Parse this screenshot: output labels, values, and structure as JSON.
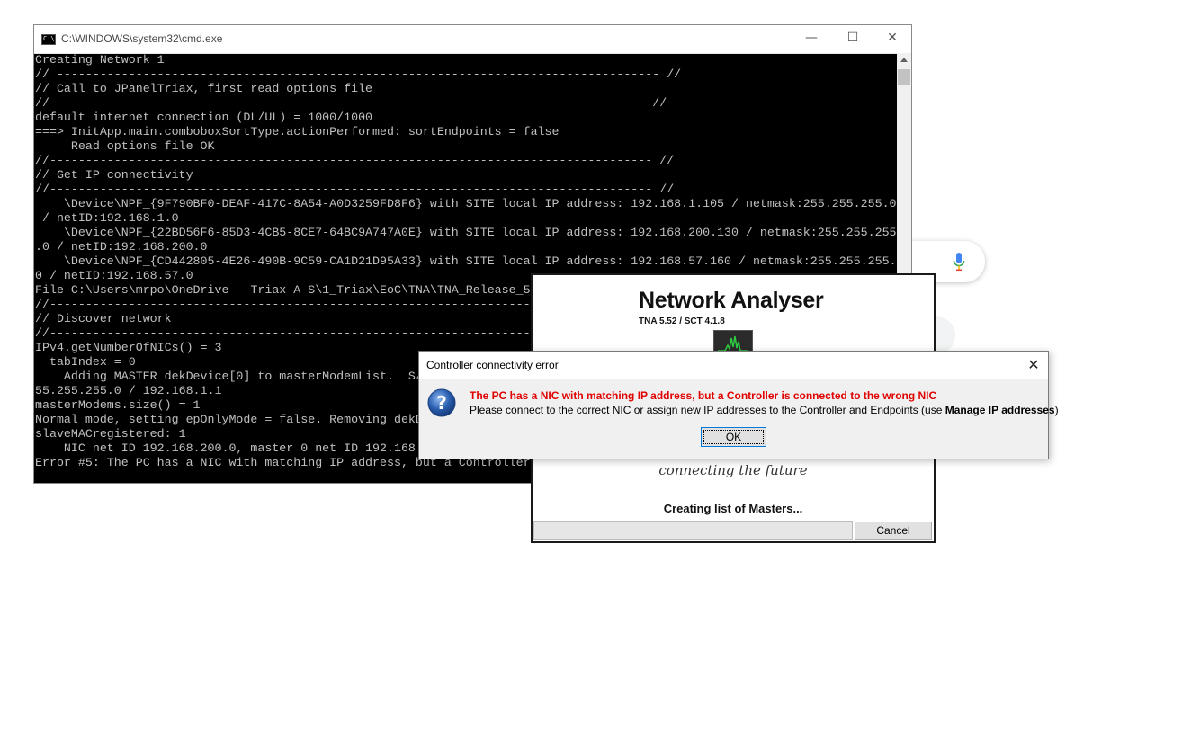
{
  "cmd": {
    "title": "C:\\WINDOWS\\system32\\cmd.exe",
    "icon_label": "C:\\",
    "lines": [
      "Creating Network 1",
      "// ------------------------------------------------------------------------------------ //",
      "// Call to JPanelTriax, first read options file",
      "// -----------------------------------------------------------------------------------//",
      "default internet connection (DL/UL) = 1000/1000",
      "===> InitApp.main.comboboxSortType.actionPerformed: sortEndpoints = false",
      "     Read options file OK",
      "//------------------------------------------------------------------------------------ //",
      "// Get IP connectivity",
      "//------------------------------------------------------------------------------------ //",
      "    \\Device\\NPF_{9F790BF0-DEAF-417C-8A54-A0D3259FD8F6} with SITE local IP address: 192.168.1.105 / netmask:255.255.255.0",
      " / netID:192.168.1.0",
      "    \\Device\\NPF_{22BD56F6-85D3-4CB5-8CE7-64BC9A747A0E} with SITE local IP address: 192.168.200.130 / netmask:255.255.255",
      ".0 / netID:192.168.200.0",
      "    \\Device\\NPF_{CD442805-4E26-490B-9C59-CA1D21D95A33} with SITE local IP address: 192.168.57.160 / netmask:255.255.255.",
      "0 / netID:192.168.57.0",
      "File C:\\Users\\mrpo\\OneDrive - Triax A S\\1_Triax\\EoC\\TNA\\TNA_Release_5",
      "//------------------------------------------------------------------------------------ //",
      "// Discover network",
      "//------------------------------------------------------------------------------------ //",
      "IPv4.getNumberOfNICs() = 3",
      "  tabIndex = 0",
      "    Adding MASTER dekDevice[0] to masterModemList.  S/",
      "55.255.255.0 / 192.168.1.1",
      "masterModems.size() = 1",
      "Normal mode, setting epOnlyMode = false. Removing dekD",
      "slaveMACregistered: 1",
      "    NIC net ID 192.168.200.0, master 0 net ID 192.168",
      "Error #5: The PC has a NIC with matching IP address, but a Controller"
    ],
    "minimize_glyph": "—",
    "maximize_glyph": "☐",
    "close_glyph": "✕"
  },
  "analyser": {
    "title": "Network Analyser",
    "version": "TNA 5.52 / SCT 4.1.8",
    "tagline": "connecting the future",
    "status": "Creating list of Masters...",
    "progress": 0.0,
    "cancel_label": "Cancel"
  },
  "dialog": {
    "title": "Controller connectivity error",
    "close_glyph": "✕",
    "message_primary": "The PC has a NIC with matching IP address, but a Controller is connected to the wrong NIC",
    "message_secondary_prefix": "Please connect to the correct NIC or assign new IP addresses to the Controller and Endpoints (use ",
    "message_secondary_bold": "Manage IP addresses",
    "message_secondary_suffix": ")",
    "ok_label": "OK"
  },
  "colors": {
    "error_red": "#e00000",
    "console_text": "#c0c0c0",
    "console_bg": "#000000",
    "dialog_bg": "#f0f0f0",
    "question_blue": "#2a5fb0"
  }
}
